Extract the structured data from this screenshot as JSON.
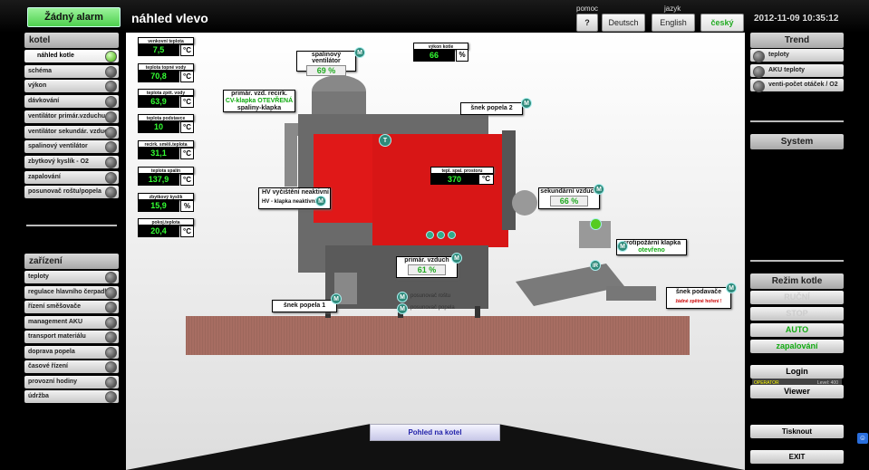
{
  "header": {
    "alarm": "Žádný alarm",
    "title": "náhled vlevo",
    "help_label": "pomoc",
    "help_btn": "?",
    "lang_label": "jazyk",
    "lang_de": "Deutsch",
    "lang_en": "English",
    "lang_cz": "český",
    "datetime": "2012-11-09 10:35:12"
  },
  "left": {
    "kotel_head": "kotel",
    "kotel_items": [
      "náhled kotle",
      "schéma",
      "výkon",
      "dávkování",
      "ventilátor primár.vzduchu",
      "ventilátor sekundár. vzduchu",
      "spalinový ventilátor",
      "zbytkový kyslík - O2",
      "zapalování",
      "posunovač roštu/popela"
    ],
    "zarizeni_head": "zařízení",
    "zarizeni_items": [
      "teploty",
      "regulace hlavního čerpadla",
      "řízení směšovače",
      "management AKU",
      "transport materiálu",
      "doprava popela",
      "časové řízení",
      "provozní hodiny",
      "údržba"
    ]
  },
  "right": {
    "trend_head": "Trend",
    "trend_items": [
      "teploty",
      "AKU teploty",
      "venti-počet otáček / O2"
    ],
    "system_head": "System",
    "mode_head": "Režim kotle",
    "mode_rucni": "RUČNÍ",
    "mode_stop": "STOP",
    "mode_auto": "AUTO",
    "mode_zapal": "zapalování",
    "login": "Login",
    "operator": "OPERATOR",
    "level": "Level: 400",
    "viewer": "Viewer",
    "print": "Tisknout",
    "exit": "EXIT"
  },
  "measurements": [
    {
      "label": "venkovní teplota",
      "value": "7,5",
      "unit": "°C"
    },
    {
      "label": "teplota topné vody",
      "value": "70,8",
      "unit": "°C"
    },
    {
      "label": "teplota zpět. vody",
      "value": "63,9",
      "unit": "°C"
    },
    {
      "label": "teplota podstavce",
      "value": "10",
      "unit": "°C"
    },
    {
      "label": "recirk. směš.teplota",
      "value": "31,1",
      "unit": "°C"
    },
    {
      "label": "teplota spalin",
      "value": "137,9",
      "unit": "°C"
    },
    {
      "label": "zbytkový kyslík",
      "value": "15,9",
      "unit": "%"
    },
    {
      "label": "pokoj.teplota",
      "value": "20,4",
      "unit": "°C"
    }
  ],
  "diagram": {
    "vykon_label": "výkon kotle",
    "vykon_value": "66",
    "vykon_unit": "%",
    "spal_vent_label": "spalinový ventilátor",
    "spal_vent_value": "69 %",
    "recirk_line1": "primár. vzd. recirk.",
    "recirk_line2": "CV-klapka OTEVŘENÁ",
    "recirk_line3": "spaliny-klapka",
    "snek2": "šnek popela 2",
    "tepl_prostor_label": "tepl. spal. prostoru",
    "tepl_prostor_value": "370",
    "tepl_prostor_unit": "°C",
    "sek_vzduch_label": "sekundární vzduch",
    "sek_vzduch_value": "66 %",
    "hv_line1": "HV vyčištění neaktivní",
    "hv_line2": "HV - klapka neaktivní",
    "protipoz_line1": "protipožární klapka",
    "protipoz_line2": "otevřeno",
    "prim_vzduch_label": "primár. vzduch",
    "prim_vzduch_value": "61 %",
    "snek1": "šnek popela 1",
    "posun_rost": "posunovač roštu",
    "posun_popel": "posunovač popela",
    "snek_podavace": "šnek podavače",
    "zadne_hoteni": "žádné zpětné hoření !",
    "m_icon": "M",
    "t_icon": "T",
    "ir_icon": "IR",
    "view_btn": "Pohled na kotel"
  },
  "colors": {
    "boiler_red": "#e01818",
    "boiler_grey": "#6a6a6a",
    "alarm_green": "#5ed85e",
    "value_green": "#33ff33",
    "teal": "#2e8a7a"
  }
}
